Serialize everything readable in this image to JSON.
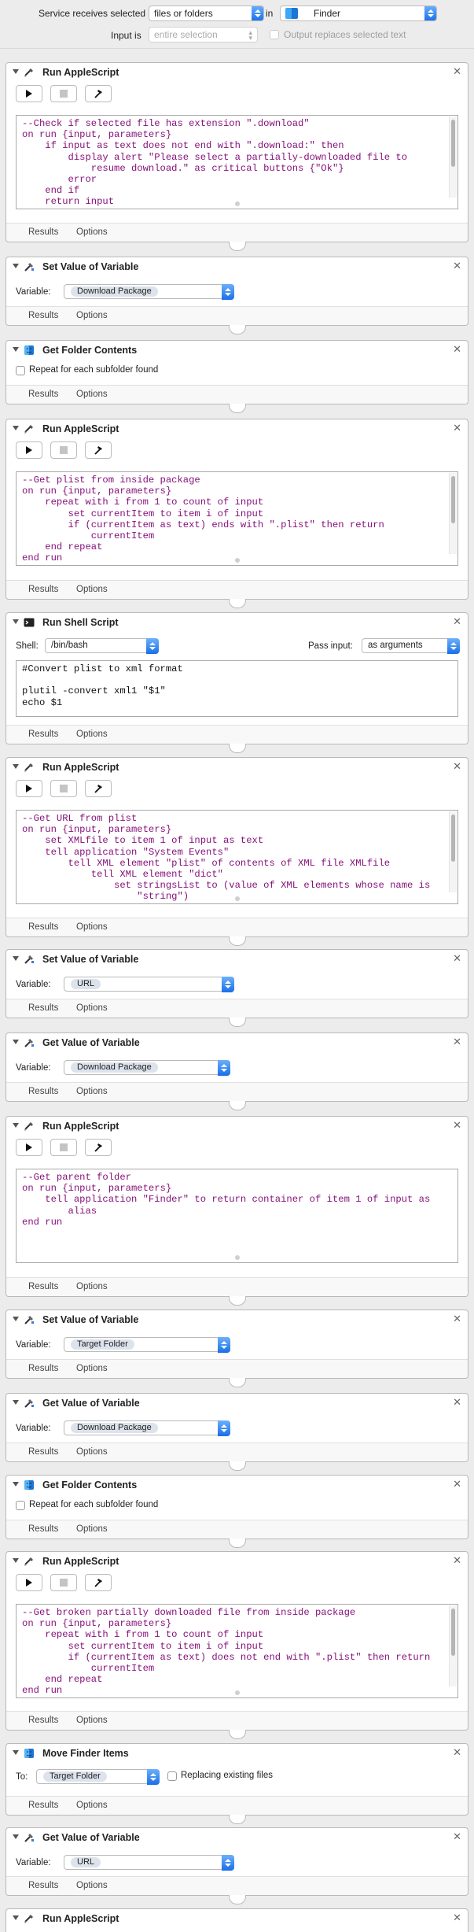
{
  "header": {
    "service_label": "Service receives selected",
    "service_value": "files or folders",
    "in_label": "in",
    "in_value": "Finder",
    "input_label": "Input is",
    "input_value": "entire selection",
    "output_replace_label": "Output replaces selected text"
  },
  "icons": {
    "applescript": "applescript-icon",
    "variable": "variable-icon",
    "finder": "finder-icon",
    "shell": "terminal-icon"
  },
  "footer": {
    "results": "Results",
    "options": "Options"
  },
  "actions": [
    {
      "title": "Run AppleScript",
      "code": "--Check if selected file has extension \".download\"\non run {input, parameters}\n    if input as text does not end with \".download:\" then\n        display alert \"Please select a partially-downloaded file to\n            resume download.\" as critical buttons {\"Ok\"}\n        error\n    end if\n    return input"
    },
    {
      "title": "Set Value of Variable",
      "variable_label": "Variable:",
      "variable": "Download Package"
    },
    {
      "title": "Get Folder Contents",
      "repeat_label": "Repeat for each subfolder found"
    },
    {
      "title": "Run AppleScript",
      "code": "--Get plist from inside package\non run {input, parameters}\n    repeat with i from 1 to count of input\n        set currentItem to item i of input\n        if (currentItem as text) ends with \".plist\" then return\n            currentItem\n    end repeat\nend run"
    },
    {
      "title": "Run Shell Script",
      "shell_label": "Shell:",
      "shell": "/bin/bash",
      "pass_label": "Pass input:",
      "pass": "as arguments",
      "code": "#Convert plist to xml format\n\nplutil -convert xml1 \"$1\"\necho $1"
    },
    {
      "title": "Run AppleScript",
      "code": "--Get URL from plist\non run {input, parameters}\n    set XMLfile to item 1 of input as text\n    tell application \"System Events\"\n        tell XML element \"plist\" of contents of XML file XMLfile\n            tell XML element \"dict\"\n                set stringsList to (value of XML elements whose name is\n                    \"string\")"
    },
    {
      "title": "Set Value of Variable",
      "variable_label": "Variable:",
      "variable": "URL"
    },
    {
      "title": "Get Value of Variable",
      "variable_label": "Variable:",
      "variable": "Download Package"
    },
    {
      "title": "Run AppleScript",
      "code": "--Get parent folder\non run {input, parameters}\n    tell application \"Finder\" to return container of item 1 of input as\n        alias\nend run"
    },
    {
      "title": "Set Value of Variable",
      "variable_label": "Variable:",
      "variable": "Target Folder"
    },
    {
      "title": "Get Value of Variable",
      "variable_label": "Variable:",
      "variable": "Download Package"
    },
    {
      "title": "Get Folder Contents",
      "repeat_label": "Repeat for each subfolder found"
    },
    {
      "title": "Run AppleScript",
      "code": "--Get broken partially downloaded file from inside package\non run {input, parameters}\n    repeat with i from 1 to count of input\n        set currentItem to item i of input\n        if (currentItem as text) does not end with \".plist\" then return\n            currentItem\n    end repeat\nend run"
    },
    {
      "title": "Move Finder Items",
      "to_label": "To:",
      "to": "Target Folder",
      "replace_label": "Replacing existing files"
    },
    {
      "title": "Get Value of Variable",
      "variable_label": "Variable:",
      "variable": "URL"
    },
    {
      "title": "Run AppleScript"
    }
  ]
}
